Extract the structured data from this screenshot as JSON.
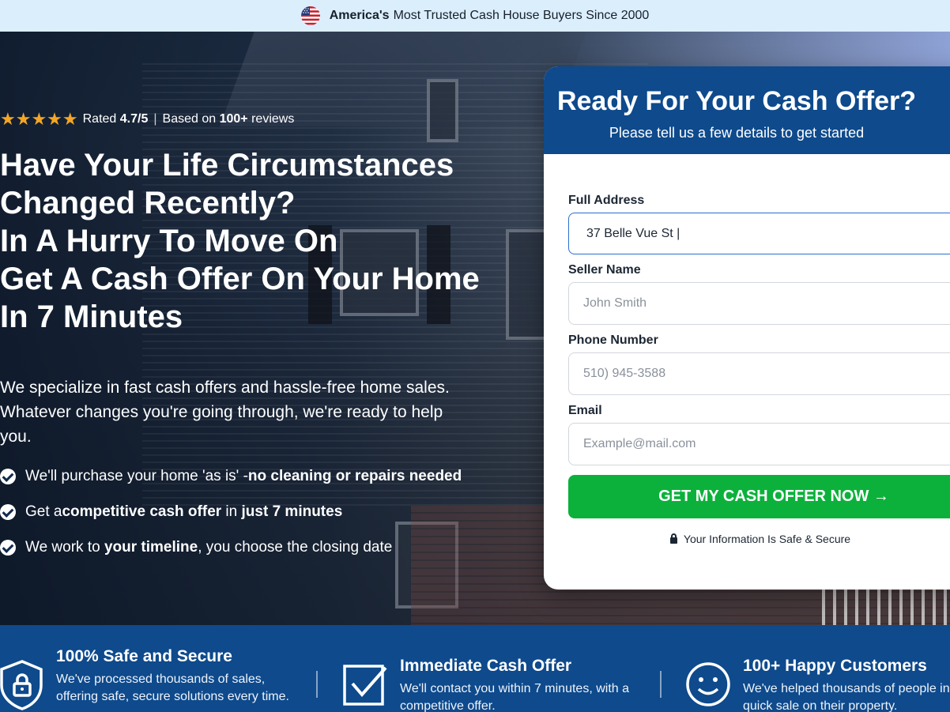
{
  "topbar": {
    "brand": "America's",
    "tagline": "Most Trusted Cash House Buyers Since 2000",
    "icon": "us-flag-icon"
  },
  "rating": {
    "stars": "★★★★★",
    "rated_prefix": "Rated",
    "score": "4.7/5",
    "separator": "|",
    "based_on": "Based on",
    "count": "100+",
    "reviews": "reviews"
  },
  "headline": [
    "Have Your Life Circumstances",
    "Changed Recently?",
    "In A Hurry To Move On",
    "Get A Cash Offer On Your Home",
    "In 7 Minutes"
  ],
  "description": "We specialize in fast cash offers and hassle-free home sales. Whatever changes you're going through, we're ready to help you.",
  "bullets": [
    {
      "pre": "We'll purchase your home 'as is' - ",
      "bold1": "no cleaning or repairs needed",
      "mid": "",
      "bold2": ""
    },
    {
      "pre": "Get a ",
      "bold1": "competitive cash offer",
      "mid": " in ",
      "bold2": "just 7 minutes"
    },
    {
      "pre": "We work to ",
      "bold1": "your timeline",
      "mid": ", you choose the closing date",
      "bold2": ""
    }
  ],
  "form": {
    "title": "Ready For Your Cash Offer?",
    "subtitle": "Please tell us a few details to get started",
    "address_label": "Full Address",
    "address_value": "37 Belle Vue St |",
    "name_label": "Seller Name",
    "name_placeholder": "John Smith",
    "phone_label": "Phone Number",
    "phone_placeholder": "510) 945-3588",
    "email_label": "Email",
    "email_placeholder": "Example@mail.com",
    "submit_label": "GET MY CASH OFFER NOW →",
    "secure_text": "Your Information Is Safe & Secure"
  },
  "features": [
    {
      "title": "100% Safe and Secure",
      "text": "We've processed thousands of sales, offering safe, secure solutions every time.",
      "icon": "shield-lock-icon"
    },
    {
      "title": "Immediate Cash Offer",
      "text": "We'll contact you within 7 minutes, with a competitive offer.",
      "icon": "checkbox-icon"
    },
    {
      "title": "100+ Happy Customers",
      "text": "We've helped thousands of people in need of a quick sale on their property.",
      "icon": "smiley-icon"
    }
  ],
  "colors": {
    "brand_blue": "#0e4a8c",
    "cta_green": "#0cb13b",
    "star": "#f5a623",
    "topbar_bg": "#dbeefc"
  }
}
